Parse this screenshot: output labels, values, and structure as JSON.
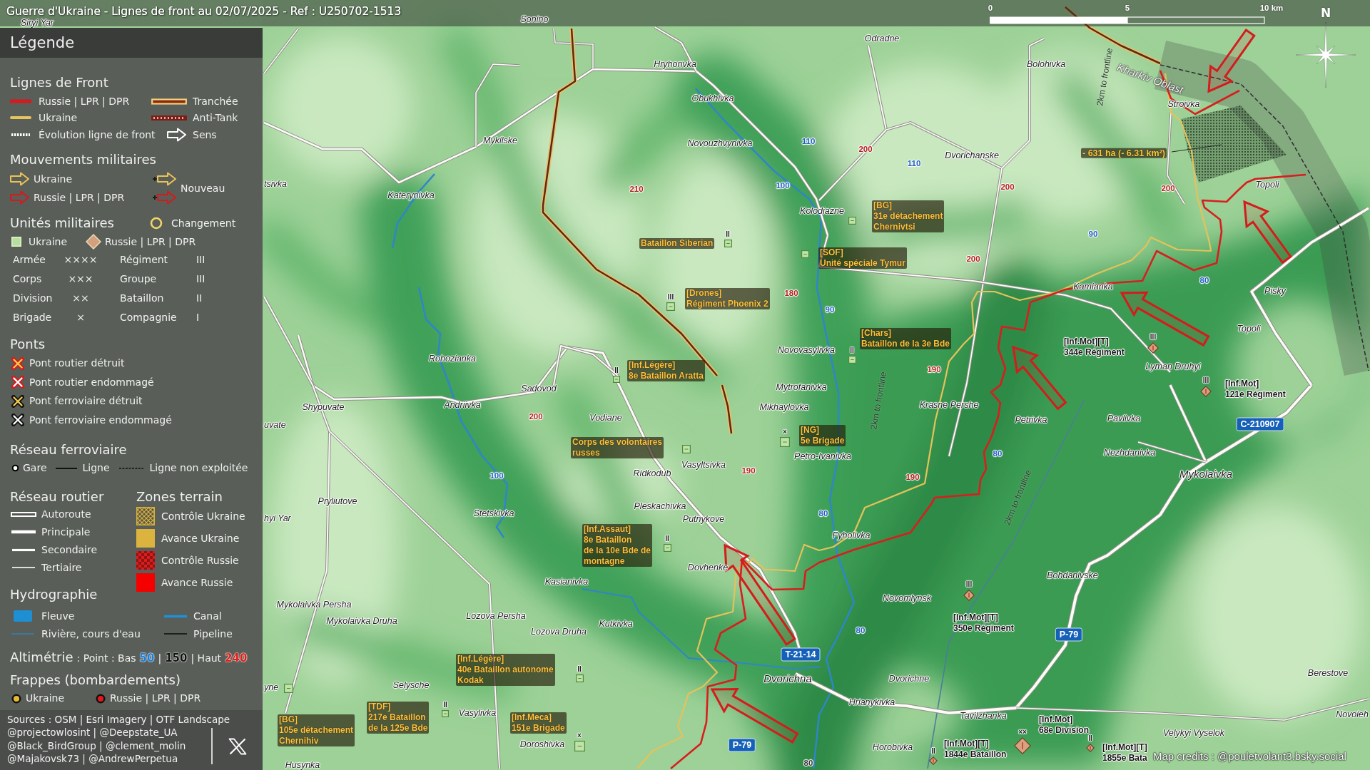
{
  "title": "Guerre d'Ukraine - Lignes de front au 02/07/2025 - Ref : U250702-1513",
  "scale_bar": {
    "ticks": [
      "0",
      "5",
      "10 km"
    ]
  },
  "compass": {
    "label": "N"
  },
  "legend": {
    "title": "Légende",
    "front_lines": {
      "heading": "Lignes de Front",
      "items": [
        {
          "kind": "russia-line",
          "label": "Russie | LPR | DPR"
        },
        {
          "kind": "trench",
          "label": "Tranchée"
        },
        {
          "kind": "ukraine-line",
          "label": "Ukraine"
        },
        {
          "kind": "anti-tank",
          "label": "Anti-Tank"
        },
        {
          "kind": "evolution",
          "label": "Évolution ligne de front"
        },
        {
          "kind": "direction",
          "label": "Sens"
        }
      ]
    },
    "movements": {
      "heading": "Mouvements militaires",
      "items": [
        {
          "kind": "ukraine-arrow",
          "label": "Ukraine"
        },
        {
          "kind": "russia-arrow",
          "label": "Russie | LPR | DPR"
        }
      ],
      "new": {
        "label": "Nouveau",
        "items": [
          {
            "kind": "ukraine-new-arrow"
          },
          {
            "kind": "russia-new-arrow"
          }
        ]
      }
    },
    "units": {
      "heading": "Unités militaires",
      "change": {
        "kind": "change",
        "label": "Changement"
      },
      "sides": [
        {
          "kind": "ukraine-unit",
          "label": "Ukraine"
        },
        {
          "kind": "russia-unit",
          "label": "Russie | LPR | DPR"
        }
      ],
      "echelons": [
        {
          "name": "Armée",
          "symbol": "××××"
        },
        {
          "name": "Corps",
          "symbol": "×××"
        },
        {
          "name": "Division",
          "symbol": "××"
        },
        {
          "name": "Brigade",
          "symbol": "×"
        },
        {
          "name": "Régiment",
          "symbol": "III"
        },
        {
          "name": "Groupe",
          "symbol": "III"
        },
        {
          "name": "Bataillon",
          "symbol": "II"
        },
        {
          "name": "Compagnie",
          "symbol": "I"
        }
      ]
    },
    "bridges": {
      "heading": "Ponts",
      "items": [
        {
          "kind": "road-destroyed",
          "label": "Pont routier détruit"
        },
        {
          "kind": "road-damaged",
          "label": "Pont routier endommagé"
        },
        {
          "kind": "rail-destroyed",
          "label": "Pont ferroviaire détruit"
        },
        {
          "kind": "rail-damaged",
          "label": "Pont ferroviaire endommagé"
        }
      ]
    },
    "railway": {
      "heading": "Réseau ferroviaire",
      "items": [
        {
          "kind": "station",
          "label": "Gare"
        },
        {
          "kind": "rail-line",
          "label": "Ligne"
        },
        {
          "kind": "rail-unused",
          "label": "Ligne non exploitée"
        }
      ]
    },
    "roads": {
      "heading": "Réseau routier",
      "items": [
        {
          "kind": "motorway",
          "label": "Autoroute"
        },
        {
          "kind": "primary",
          "label": "Principale"
        },
        {
          "kind": "secondary",
          "label": "Secondaire"
        },
        {
          "kind": "tertiary",
          "label": "Tertiaire"
        }
      ]
    },
    "zones": {
      "heading": "Zones terrain",
      "items": [
        {
          "kind": "ukraine-control",
          "label": "Contrôle Ukraine"
        },
        {
          "kind": "ukraine-advance",
          "label": "Avance Ukraine"
        },
        {
          "kind": "russia-control",
          "label": "Contrôle Russie"
        },
        {
          "kind": "russia-advance",
          "label": "Avance Russie"
        }
      ]
    },
    "hydrography": {
      "heading": "Hydrographie",
      "items": [
        {
          "kind": "river-area",
          "label": "Fleuve"
        },
        {
          "kind": "canal",
          "label": "Canal"
        },
        {
          "kind": "stream",
          "label": "Rivière, cours d'eau"
        },
        {
          "kind": "pipeline",
          "label": "Pipeline"
        }
      ]
    },
    "altimetry": {
      "heading": "Altimétrie",
      "parts": [
        {
          "kind": "text",
          "text": ": Point : Bas"
        },
        {
          "kind": "low",
          "text": "50"
        },
        {
          "kind": "text",
          "text": "|"
        },
        {
          "kind": "mid",
          "text": "150"
        },
        {
          "kind": "text",
          "text": "| Haut"
        },
        {
          "kind": "high",
          "text": "240"
        }
      ]
    },
    "strikes": {
      "heading": "Frappes (bombardements)",
      "items": [
        {
          "kind": "ukraine-strike",
          "label": "Ukraine"
        },
        {
          "kind": "russia-strike",
          "label": "Russie | LPR | DPR"
        }
      ]
    },
    "sources": [
      "Sources : OSM | Esri Imagery | OTF Landscape",
      "@projectowlosint | @Deepstate_UA",
      "@Black_BirdGroup | @clement_molin",
      "@Majakovsk73 | @AndrewPerpetua"
    ]
  },
  "map": {
    "places": [
      {
        "name": "Siryi Yar",
        "kind": "town"
      },
      {
        "name": "Sonino",
        "kind": "town"
      },
      {
        "name": "Odradne",
        "kind": "town"
      },
      {
        "name": "Hryhorivka",
        "kind": "town"
      },
      {
        "name": "Bolohivka",
        "kind": "town"
      },
      {
        "name": "Obukhivka",
        "kind": "town"
      },
      {
        "name": "2km to frontline",
        "kind": "buffer"
      },
      {
        "name": "Kharkiv Oblast",
        "kind": "region"
      },
      {
        "name": "Stroivka",
        "kind": "town"
      },
      {
        "name": "Mykilske",
        "kind": "town"
      },
      {
        "name": "Novouzhvynivka",
        "kind": "town"
      },
      {
        "name": "Dvorichanske",
        "kind": "town"
      },
      {
        "name": "tsivka",
        "kind": "town"
      },
      {
        "name": "Topoli",
        "kind": "town"
      },
      {
        "name": "Katerynivka",
        "kind": "town"
      },
      {
        "name": "Kolodiazne",
        "kind": "town"
      },
      {
        "name": "Kamianka",
        "kind": "town"
      },
      {
        "name": "Pisky",
        "kind": "town"
      },
      {
        "name": "Topoli",
        "kind": "town"
      },
      {
        "name": "Novovasylivka",
        "kind": "town"
      },
      {
        "name": "Rohozianka",
        "kind": "town"
      },
      {
        "name": "Lyman Druhyi",
        "kind": "town"
      },
      {
        "name": "Sadovod",
        "kind": "town"
      },
      {
        "name": "Mytrofanivka",
        "kind": "town"
      },
      {
        "name": "Shypuvate",
        "kind": "town"
      },
      {
        "name": "Andriivka",
        "kind": "town"
      },
      {
        "name": "Mikhaylovka",
        "kind": "town"
      },
      {
        "name": "2km to frontline",
        "kind": "buffer"
      },
      {
        "name": "Krasne Pershe",
        "kind": "town"
      },
      {
        "name": "uvate",
        "kind": "town"
      },
      {
        "name": "Vodiane",
        "kind": "town"
      },
      {
        "name": "Petrivka",
        "kind": "town"
      },
      {
        "name": "Pavlivka",
        "kind": "town"
      },
      {
        "name": "Petro-Ivanivka",
        "kind": "town"
      },
      {
        "name": "Nezhdanivka",
        "kind": "town"
      },
      {
        "name": "Ridkodub",
        "kind": "town"
      },
      {
        "name": "Vasyltsivka",
        "kind": "town"
      },
      {
        "name": "Mykolaivka",
        "kind": "city"
      },
      {
        "name": "Pryliutove",
        "kind": "town"
      },
      {
        "name": "Stetskivka",
        "kind": "town"
      },
      {
        "name": "Pleskachivka",
        "kind": "town"
      },
      {
        "name": "hyi Yar",
        "kind": "town"
      },
      {
        "name": "Putnykove",
        "kind": "town"
      },
      {
        "name": "2km to frontline",
        "kind": "buffer"
      },
      {
        "name": "Fyholivka",
        "kind": "town"
      },
      {
        "name": "Dovhenke",
        "kind": "town"
      },
      {
        "name": "Kasianivka",
        "kind": "town"
      },
      {
        "name": "Bohdanivske",
        "kind": "town"
      },
      {
        "name": "Mykolaivka Persha",
        "kind": "town"
      },
      {
        "name": "Novomlynsk",
        "kind": "town"
      },
      {
        "name": "Mykolaivka Druha",
        "kind": "town"
      },
      {
        "name": "Lozova Persha",
        "kind": "town"
      },
      {
        "name": "Lozova Druha",
        "kind": "town"
      },
      {
        "name": "Kutkivka",
        "kind": "town"
      },
      {
        "name": "yne",
        "kind": "town"
      },
      {
        "name": "Selysche",
        "kind": "town"
      },
      {
        "name": "Dvorichna",
        "kind": "city"
      },
      {
        "name": "Dvorichne",
        "kind": "town"
      },
      {
        "name": "Berestove",
        "kind": "town"
      },
      {
        "name": "Hrianykivka",
        "kind": "town"
      },
      {
        "name": "Vasylivka",
        "kind": "town"
      },
      {
        "name": "Tavilzhanka",
        "kind": "town"
      },
      {
        "name": "Novoieh",
        "kind": "town"
      },
      {
        "name": "Velykyi Vyselok",
        "kind": "town"
      },
      {
        "name": "Doroshivka",
        "kind": "town"
      },
      {
        "name": "Horobivka",
        "kind": "town"
      },
      {
        "name": "Husynka",
        "kind": "town"
      }
    ],
    "elevations": [
      {
        "value": "110",
        "color": "#1f5fc4"
      },
      {
        "value": "200",
        "color": "#b0231b"
      },
      {
        "value": "110",
        "color": "#1f5fc4"
      },
      {
        "value": "210",
        "color": "#b0231b"
      },
      {
        "value": "100",
        "color": "#1f5fc4"
      },
      {
        "value": "200",
        "color": "#b0231b"
      },
      {
        "value": "200",
        "color": "#b0231b"
      },
      {
        "value": "90",
        "color": "#1f5fc4"
      },
      {
        "value": "200",
        "color": "#b0231b"
      },
      {
        "value": "80",
        "color": "#1f5fc4"
      },
      {
        "value": "180",
        "color": "#b0231b"
      },
      {
        "value": "90",
        "color": "#1f5fc4"
      },
      {
        "value": "190",
        "color": "#b0231b"
      },
      {
        "value": "200",
        "color": "#b0231b"
      },
      {
        "value": "80",
        "color": "#1f5fc4"
      },
      {
        "value": "100",
        "color": "#1f5fc4"
      },
      {
        "value": "190",
        "color": "#b0231b"
      },
      {
        "value": "190",
        "color": "#b0231b"
      },
      {
        "value": "80",
        "color": "#1f5fc4"
      },
      {
        "value": "80",
        "color": "#1f5fc4"
      },
      {
        "value": "80",
        "color": "#3a3a3a"
      }
    ],
    "road_numbers": [
      "C-210907",
      "P-79",
      "T-21-14",
      "P-79"
    ],
    "units": [
      {
        "kind": "ukraine",
        "lines": [
          "[BG]",
          "31e détachement",
          "Chernivtsi"
        ]
      },
      {
        "kind": "ukraine",
        "echelon": "II",
        "lines": [
          "Bataillon Siberian"
        ]
      },
      {
        "kind": "ukraine",
        "lines": [
          "[SOF]",
          "Unité spéciale Tymur"
        ]
      },
      {
        "kind": "ukraine",
        "echelon": "III",
        "lines": [
          "[Drones]",
          "Régiment Phoenix 2"
        ]
      },
      {
        "kind": "ukraine",
        "echelon": "II",
        "lines": [
          "[Chars]",
          "Bataillon de la 3e Bde"
        ]
      },
      {
        "kind": "russia",
        "echelon": "III",
        "lines": [
          "[Inf.Mot][T]",
          "344e Régiment"
        ]
      },
      {
        "kind": "ukraine",
        "echelon": "II",
        "lines": [
          "[Inf.Légère]",
          "8e Bataillon Aratta"
        ]
      },
      {
        "kind": "russia",
        "echelon": "III",
        "lines": [
          "[Inf.Mot]",
          "121e Régiment"
        ]
      },
      {
        "kind": "ukraine",
        "lines": [
          "Corps des volontaires",
          "russes"
        ]
      },
      {
        "kind": "ukraine",
        "echelon": "×",
        "lines": [
          "[NG]",
          "5e Brigade"
        ]
      },
      {
        "kind": "ukraine",
        "echelon": "II",
        "lines": [
          "[Inf.Assaut]",
          "8e Bataillon",
          "de la 10e Bde de",
          "montagne"
        ]
      },
      {
        "kind": "russia",
        "echelon": "III",
        "lines": [
          "[Inf.Mot][T]",
          "350e Régiment"
        ]
      },
      {
        "kind": "ukraine",
        "echelon": "II",
        "lines": [
          "[Inf.Légère]",
          "40e Bataillon autonome",
          "Kodak"
        ]
      },
      {
        "kind": "ukraine",
        "lines": [
          "[BG]",
          "105e détachement",
          "Chernihiv"
        ]
      },
      {
        "kind": "ukraine",
        "echelon": "II",
        "lines": [
          "[TDF]",
          "217e Bataillon",
          "de la 125e Bde"
        ]
      },
      {
        "kind": "ukraine",
        "echelon": "×",
        "lines": [
          "[Inf.Meca]",
          "151e Brigade"
        ]
      },
      {
        "kind": "russia",
        "echelon": "××",
        "lines": [
          "[Inf.Mot]",
          "68e Division"
        ]
      },
      {
        "kind": "russia",
        "echelon": "II",
        "lines": [
          "[Inf.Mot][T]",
          "1844e Bataillon"
        ]
      },
      {
        "kind": "russia",
        "echelon": "II",
        "lines": [
          "[Inf.Mot][T]",
          "1855e Bata"
        ]
      }
    ],
    "area_note": "- 631 ha (- 6.31 km²)"
  },
  "credits": "Map credits : @pouletvolant3.bsky.social"
}
